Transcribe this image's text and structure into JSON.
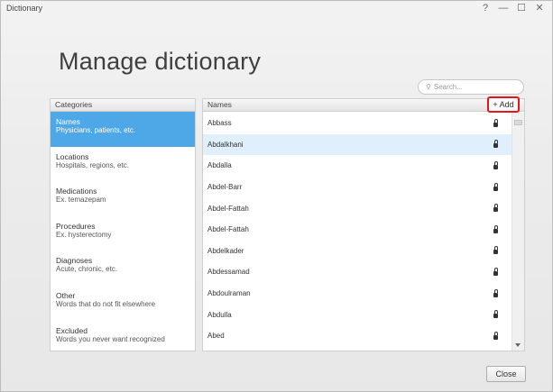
{
  "window": {
    "title": "Dictionary",
    "controls": {
      "help": "?",
      "minimize": "—",
      "maximize": "☐",
      "close": "✕"
    }
  },
  "heading": "Manage dictionary",
  "search": {
    "placeholder": "Search...",
    "icon": "search-icon"
  },
  "categories": {
    "header": "Categories",
    "items": [
      {
        "name": "Names",
        "desc": "Physicians, patients, etc.",
        "selected": true
      },
      {
        "name": "Locations",
        "desc": "Hospitals, regions, etc."
      },
      {
        "name": "Medications",
        "desc": "Ex. temazepam"
      },
      {
        "name": "Procedures",
        "desc": "Ex. hysterectomy"
      },
      {
        "name": "Diagnoses",
        "desc": "Acute, chronic, etc."
      },
      {
        "name": "Other",
        "desc": "Words that do not fit elsewhere"
      },
      {
        "name": "Excluded",
        "desc": "Words you never want recognized"
      }
    ]
  },
  "names": {
    "header": "Names",
    "add_label": "+ Add",
    "rows": [
      {
        "name": "Abbass"
      },
      {
        "name": "Abdalkhani",
        "selected": true
      },
      {
        "name": "Abdalla"
      },
      {
        "name": "Abdel-Barr"
      },
      {
        "name": "Abdel-Fattah"
      },
      {
        "name": "Abdel-Fattah"
      },
      {
        "name": "Abdelkader"
      },
      {
        "name": "Abdessamad"
      },
      {
        "name": "Abdoulraman"
      },
      {
        "name": "Abdulla"
      },
      {
        "name": "Abed"
      }
    ]
  },
  "footer": {
    "close_label": "Close"
  },
  "colors": {
    "selection": "#4ea8e8",
    "row_selection": "#dfeffb",
    "add_highlight": "#e01818"
  }
}
